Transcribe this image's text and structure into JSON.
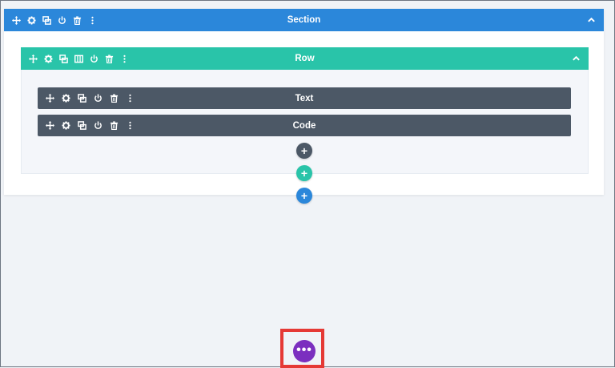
{
  "section": {
    "title": "Section"
  },
  "row": {
    "title": "Row"
  },
  "modules": [
    {
      "title": "Text"
    },
    {
      "title": "Code"
    }
  ],
  "add_buttons": {
    "symbol": "+"
  },
  "more_button": {
    "symbol": "•••"
  },
  "colors": {
    "section": "#2b87da",
    "row": "#29c4a9",
    "module": "#4c5866",
    "more": "#7b2fbf",
    "highlight": "#e53935"
  },
  "icons": {
    "section_toolbar": [
      "move-icon",
      "gear-icon",
      "duplicate-icon",
      "power-icon",
      "trash-icon",
      "more-vertical-icon"
    ],
    "row_toolbar": [
      "move-icon",
      "gear-icon",
      "duplicate-icon",
      "columns-icon",
      "power-icon",
      "trash-icon",
      "more-vertical-icon"
    ],
    "module_toolbar": [
      "move-icon",
      "gear-icon",
      "duplicate-icon",
      "power-icon",
      "trash-icon",
      "more-vertical-icon"
    ],
    "collapse": "chevron-up-icon"
  }
}
